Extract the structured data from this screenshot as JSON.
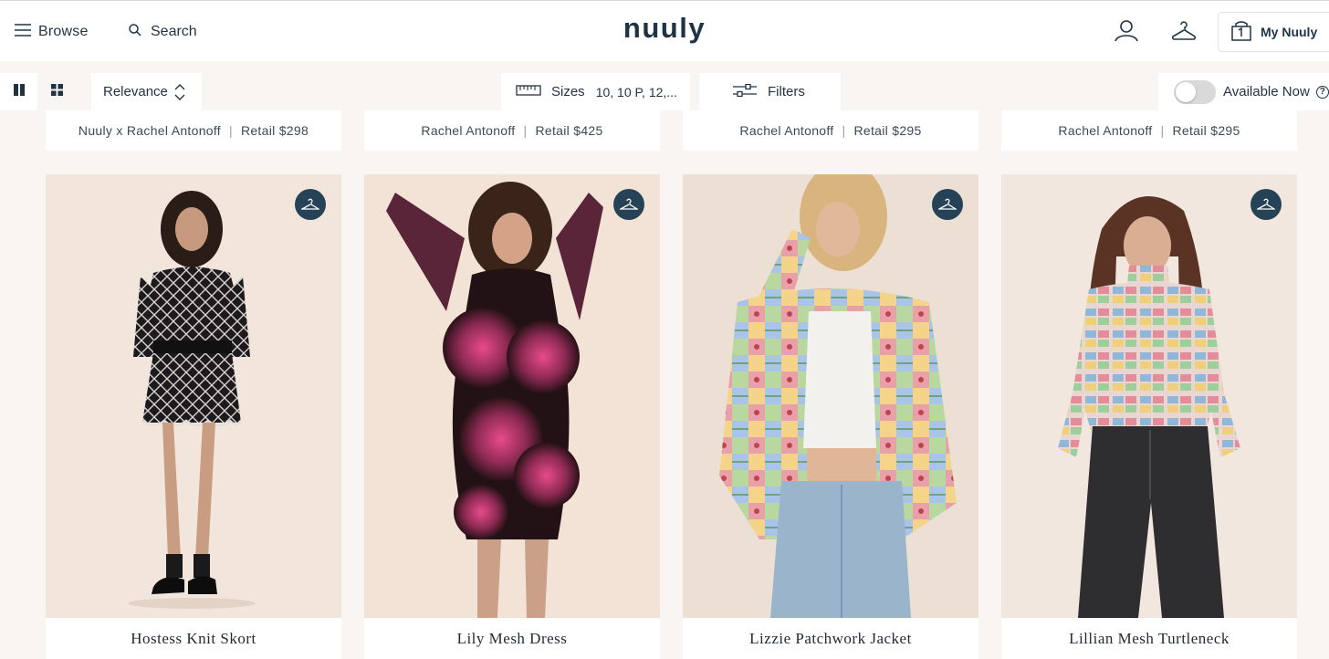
{
  "header": {
    "browse_label": "Browse",
    "search_label": "Search",
    "logo": "nuuly",
    "my_nuuly_label": "My Nuuly"
  },
  "toolbar": {
    "sort_label": "Relevance",
    "sizes_label": "Sizes",
    "sizes_value": "10, 10 P, 12,...",
    "filters_label": "Filters",
    "available_now_label": "Available Now",
    "available_now_on": false,
    "help_glyph": "?"
  },
  "previous_row": [
    {
      "brand": "Nuuly x Rachel Antonoff",
      "retail": "Retail $298"
    },
    {
      "brand": "Rachel Antonoff",
      "retail": "Retail $425"
    },
    {
      "brand": "Rachel Antonoff",
      "retail": "Retail $295"
    },
    {
      "brand": "Rachel Antonoff",
      "retail": "Retail $295"
    }
  ],
  "separator": "|",
  "products": [
    {
      "name": "Hostess Knit Skort"
    },
    {
      "name": "Lily Mesh Dress"
    },
    {
      "name": "Lizzie Patchwork Jacket"
    },
    {
      "name": "Lillian Mesh Turtleneck"
    }
  ],
  "colors": {
    "brand": "#1f3344",
    "badge": "#254256",
    "page_bg": "#f8f5f2"
  },
  "icons": [
    "menu-icon",
    "search-icon",
    "account-icon",
    "closet-hanger-icon",
    "bag-icon",
    "single-view-icon",
    "grid-view-icon",
    "sort-chevron-icon",
    "ruler-icon",
    "sliders-icon",
    "help-icon",
    "hanger-icon"
  ]
}
